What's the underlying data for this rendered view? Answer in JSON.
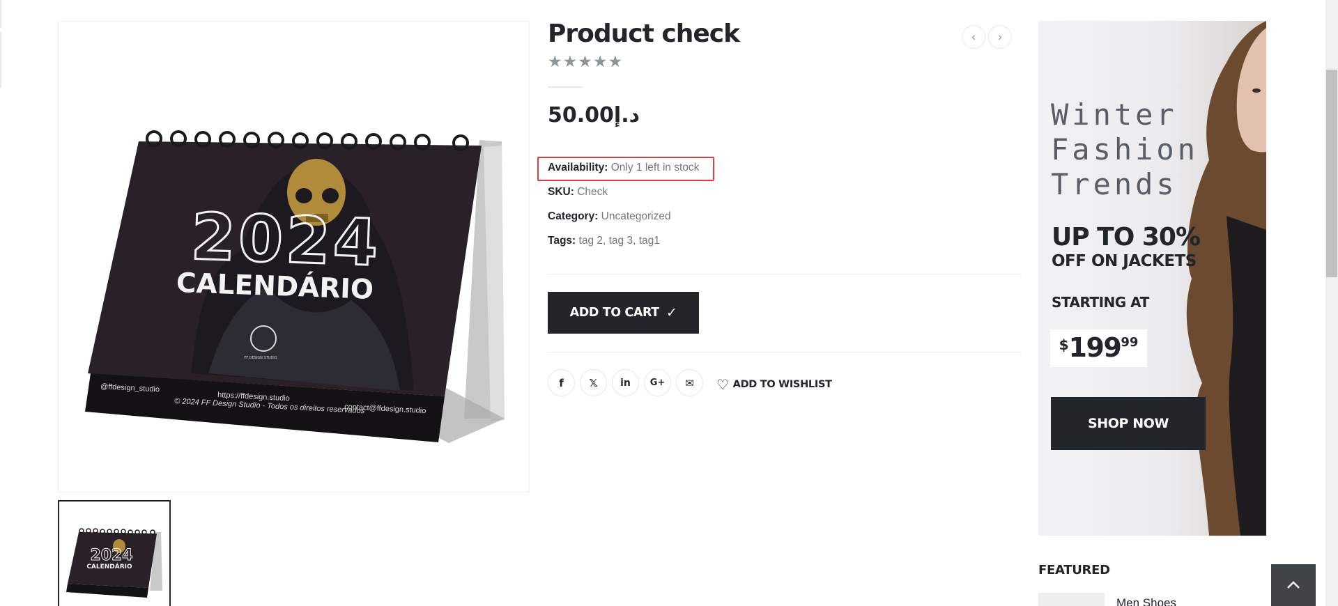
{
  "product": {
    "title": "Product check",
    "rating_stars": "★★★★★",
    "price": "50.00د.إ",
    "availability_label": "Availability:",
    "availability_value": "Only 1 left in stock",
    "sku_label": "SKU:",
    "sku_value": "Check",
    "category_label": "Category:",
    "category_value": "Uncategorized",
    "tags_label": "Tags:",
    "tags": [
      "tag 2",
      "tag 3",
      "tag1"
    ],
    "add_to_cart_label": "ADD TO CART",
    "add_to_wishlist_label": "ADD TO WISHLIST"
  },
  "navigation": {
    "prev_icon": "chevron-left-icon",
    "next_icon": "chevron-right-icon"
  },
  "share": {
    "items": [
      {
        "name": "facebook",
        "glyph": "f"
      },
      {
        "name": "x-twitter",
        "glyph": "𝕏"
      },
      {
        "name": "linkedin",
        "glyph": "in"
      },
      {
        "name": "google-plus",
        "glyph": "G+"
      },
      {
        "name": "email",
        "glyph": "✉"
      }
    ]
  },
  "product_image": {
    "year": "2024",
    "calendar_title": "CALENDÁRIO",
    "studio_logo_text": "FF DESIGN STUDIO",
    "handle": "@ffdesign_studio",
    "website": "https://ffdesign.studio",
    "contact": "contact@ffdesign.studio",
    "copyright": "© 2024 FF Design Studio - Todos os direitos reservados"
  },
  "banner": {
    "script_line1": "Winter",
    "script_line2": "Fashion",
    "script_line3": "Trends",
    "headline": "UP TO 30%",
    "subline": "OFF ON JACKETS",
    "starting_at": "STARTING AT",
    "price_currency": "$",
    "price_main": "199",
    "price_cents": "99",
    "cta_label": "SHOP NOW"
  },
  "sidebar": {
    "featured_title": "FEATURED",
    "featured_items": [
      {
        "name": "Men Shoes"
      }
    ]
  },
  "colors": {
    "primary_dark": "#222529",
    "highlight_red": "#e5393b",
    "muted_text": "#777777",
    "star_grey": "#8e959b"
  }
}
